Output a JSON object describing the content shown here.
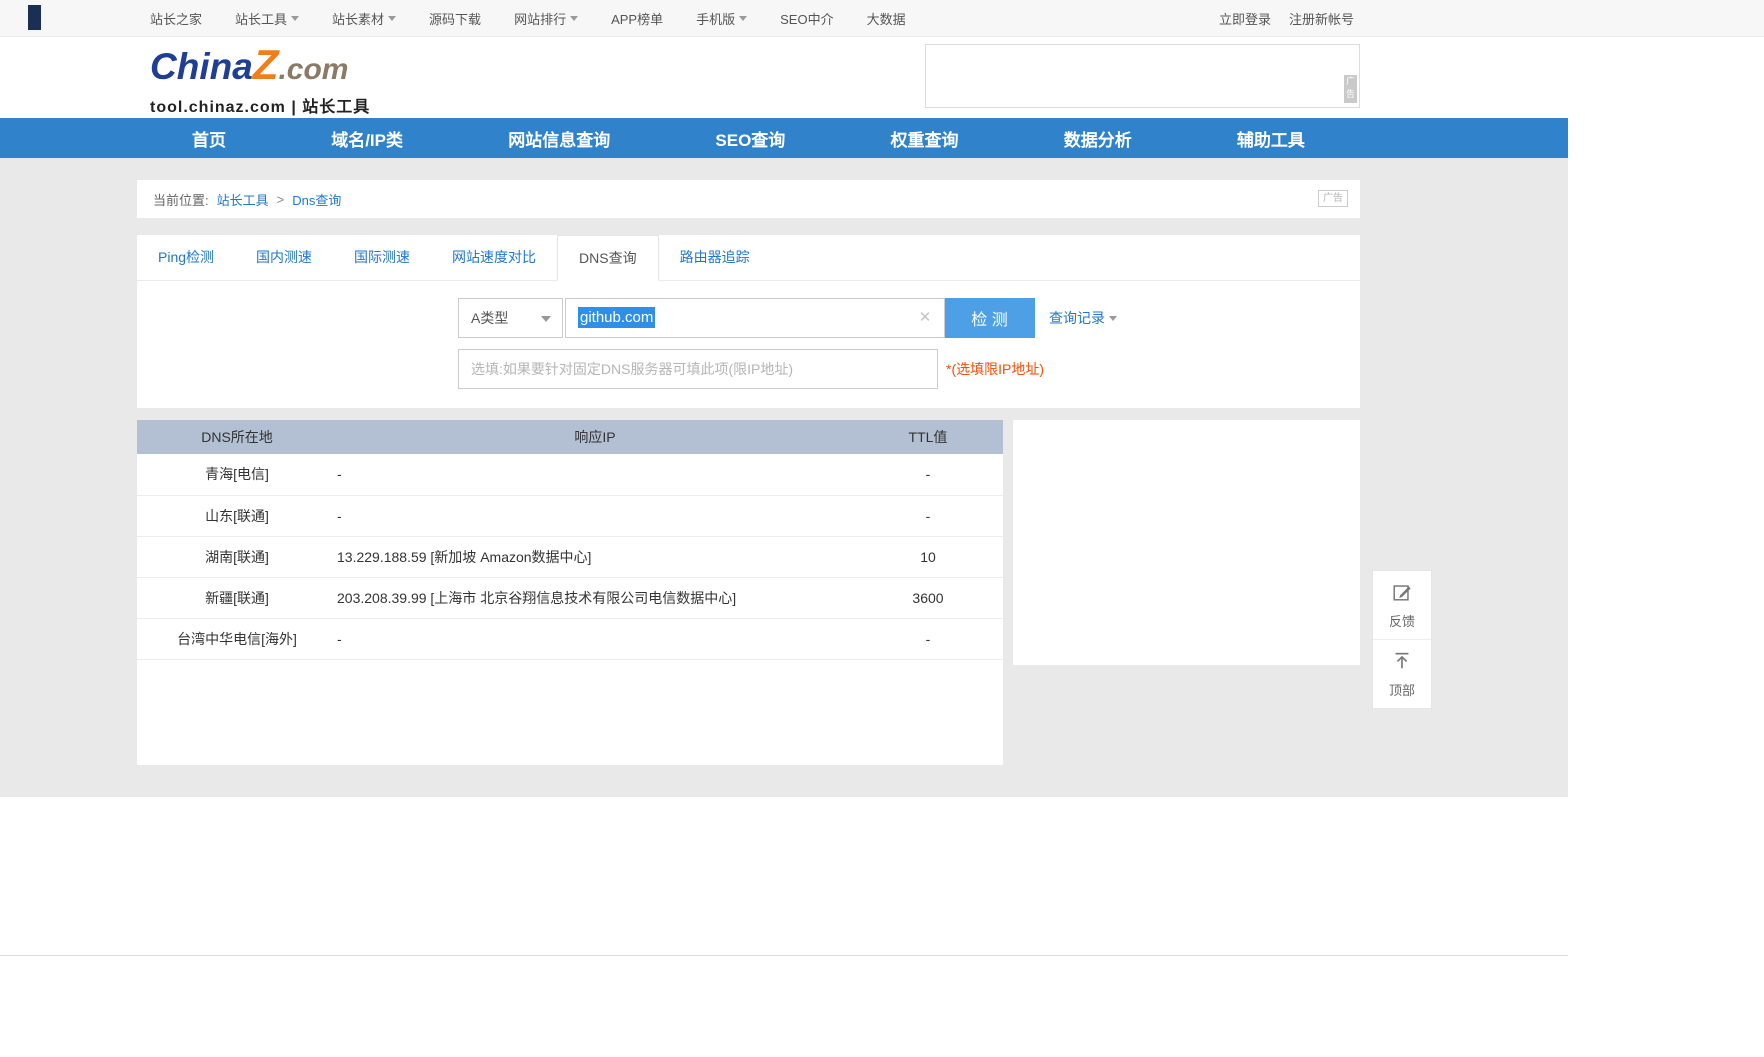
{
  "colors": {
    "nav_blue": "#3083ca",
    "button_blue": "#4da0e6",
    "link_blue": "#2277cc",
    "table_header_bg": "#b3bfd3",
    "note_orange": "#ff4a00",
    "selection_blue": "#2e8ee8",
    "logo_blue": "#1e3f94",
    "logo_orange": "#f07f1a"
  },
  "topbar": {
    "links": [
      {
        "label": "站长之家",
        "dropdown": false
      },
      {
        "label": "站长工具",
        "dropdown": true
      },
      {
        "label": "站长素材",
        "dropdown": true
      },
      {
        "label": "源码下载",
        "dropdown": false
      },
      {
        "label": "网站排行",
        "dropdown": true
      },
      {
        "label": "APP榜单",
        "dropdown": false
      },
      {
        "label": "手机版",
        "dropdown": true
      },
      {
        "label": "SEO中介",
        "dropdown": false
      },
      {
        "label": "大数据",
        "dropdown": false
      }
    ],
    "login": "立即登录",
    "register": "注册新帐号"
  },
  "header": {
    "logo_china": "China",
    "logo_z": "Z",
    "logo_com": ".com",
    "logo_sub": "tool.chinaz.com | 站长工具",
    "ad_tag": "广告"
  },
  "nav": {
    "items": [
      "首页",
      "域名/IP类",
      "网站信息查询",
      "SEO查询",
      "权重查询",
      "数据分析",
      "辅助工具"
    ]
  },
  "breadcrumb": {
    "label": "当前位置:",
    "root": "站长工具",
    "separator": ">",
    "current": "Dns查询",
    "ad_tag": "广告"
  },
  "tabs": [
    {
      "label": "Ping检测",
      "active": false
    },
    {
      "label": "国内测速",
      "active": false
    },
    {
      "label": "国际测速",
      "active": false
    },
    {
      "label": "网站速度对比",
      "active": false
    },
    {
      "label": "DNS查询",
      "active": true
    },
    {
      "label": "路由器追踪",
      "active": false
    }
  ],
  "form": {
    "record_type": "A类型",
    "domain_value": "github.com",
    "detect_button": "检 测",
    "history_link": "查询记录",
    "dns_server_placeholder": "选填:如果要针对固定DNS服务器可填此项(限IP地址)",
    "dns_server_note": "*(选填限IP地址)"
  },
  "result_table": {
    "headers": [
      "DNS所在地",
      "响应IP",
      "TTL值"
    ],
    "rows": [
      {
        "location": "青海[电信]",
        "ip": "-",
        "ttl": "-"
      },
      {
        "location": "山东[联通]",
        "ip": "-",
        "ttl": "-"
      },
      {
        "location": "湖南[联通]",
        "ip": "13.229.188.59 [新加坡 Amazon数据中心]",
        "ttl": "10"
      },
      {
        "location": "新疆[联通]",
        "ip": "203.208.39.99 [上海市 北京谷翔信息技术有限公司电信数据中心]",
        "ttl": "3600"
      },
      {
        "location": "台湾中华电信[海外]",
        "ip": "-",
        "ttl": "-"
      }
    ]
  },
  "floatbar": {
    "feedback": "反馈",
    "to_top": "顶部"
  }
}
